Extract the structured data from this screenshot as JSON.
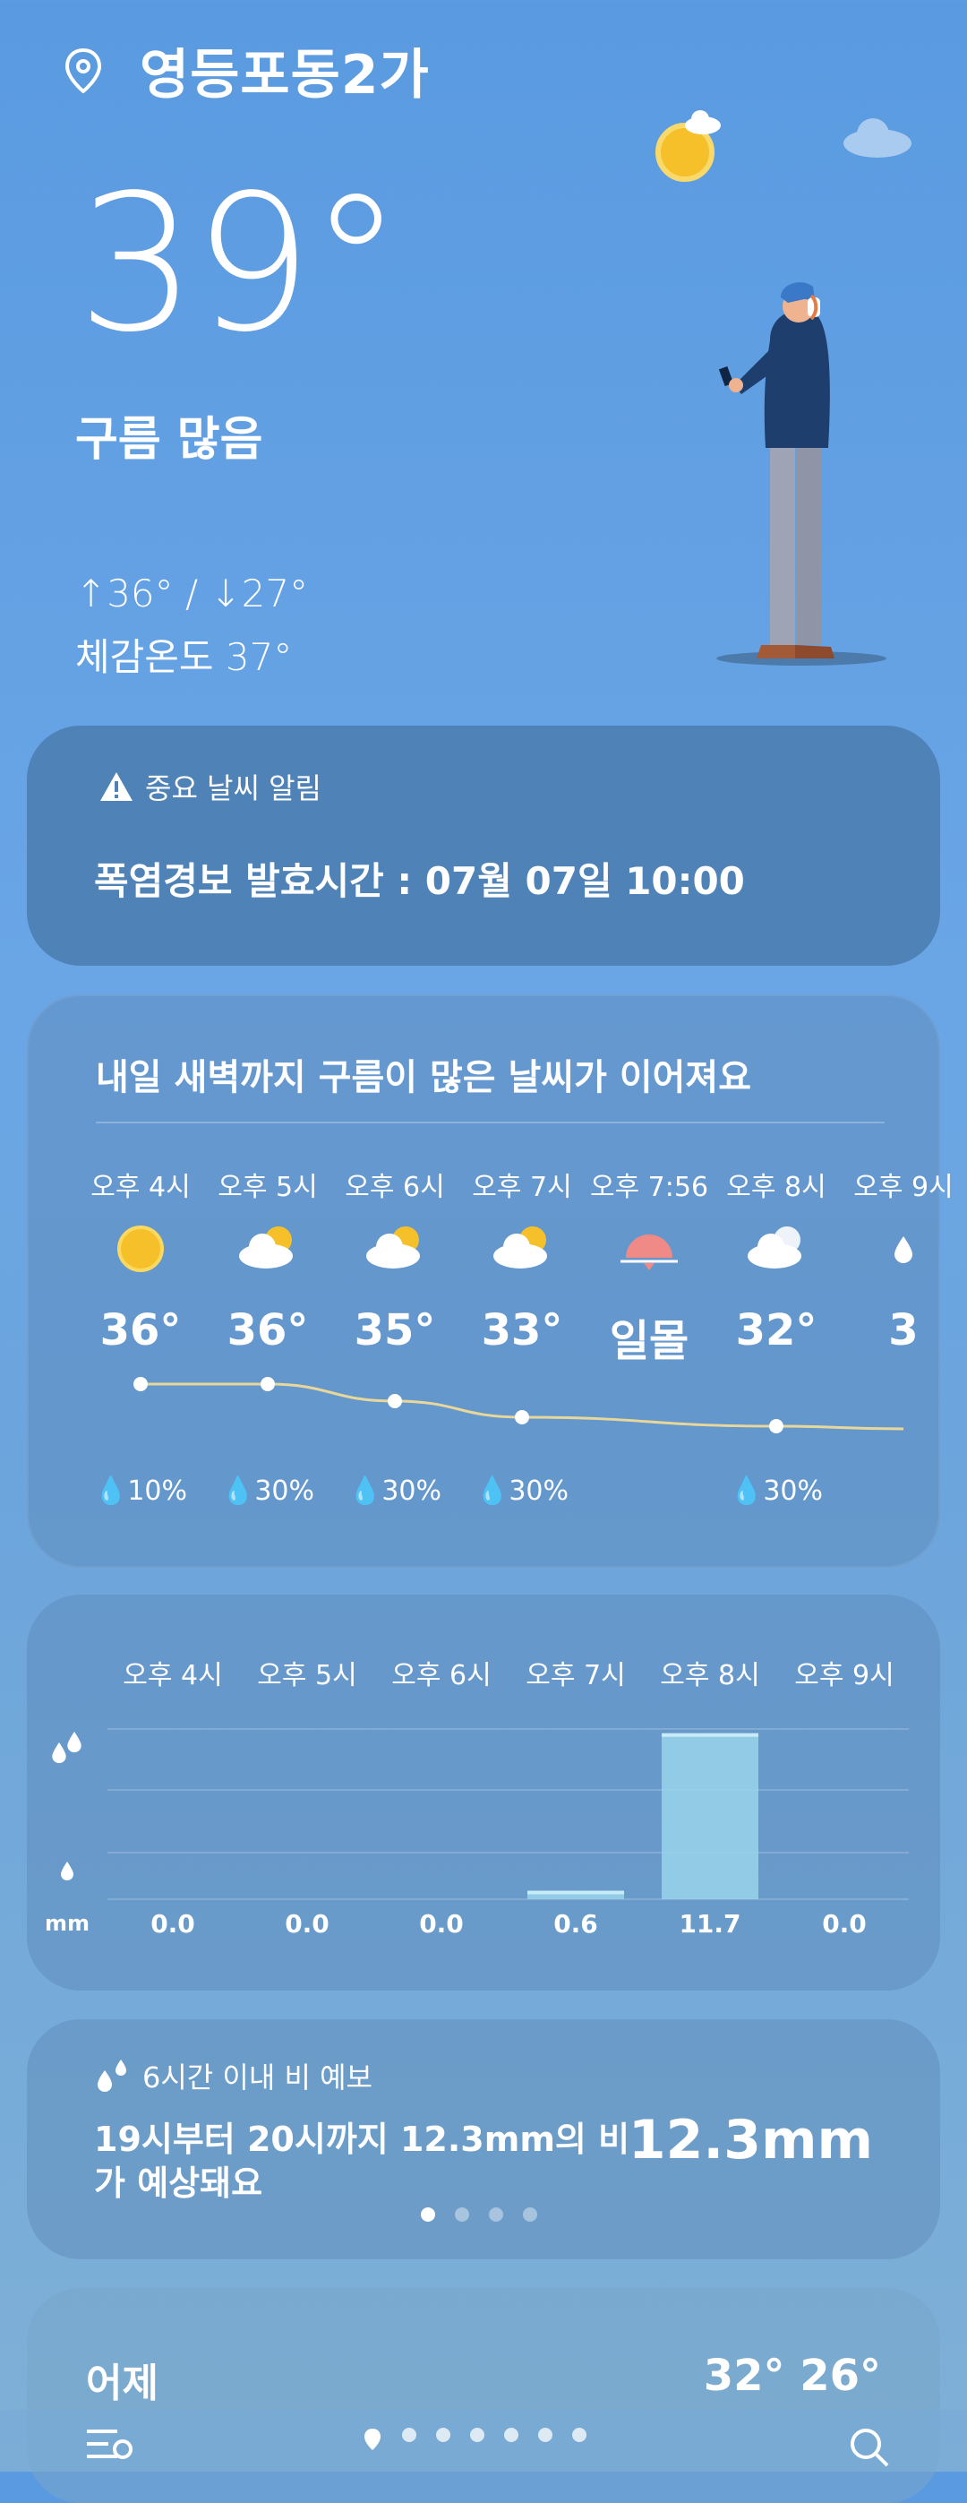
{
  "header": {
    "location": "영등포동2가"
  },
  "current": {
    "temp": "39°",
    "condition": "구름 많음",
    "hilo": "↑36° / ↓27°",
    "feels_like": "체감온도 37°"
  },
  "alert": {
    "title": "중요 날씨 알림",
    "text": "폭염경보  발효시간 : 07월 07일 10:00"
  },
  "hourly": {
    "title": "내일 새벽까지 구름이 많은 날씨가 이어져요",
    "items": [
      {
        "time": "오후 4시",
        "temp": "36°",
        "pop": "10%",
        "icon": "sun-icon"
      },
      {
        "time": "오후 5시",
        "temp": "36°",
        "pop": "30%",
        "icon": "partly-cloudy-icon"
      },
      {
        "time": "오후 6시",
        "temp": "35°",
        "pop": "30%",
        "icon": "partly-cloudy-icon"
      },
      {
        "time": "오후 7시",
        "temp": "33°",
        "pop": "30%",
        "icon": "partly-cloudy-icon"
      },
      {
        "time": "오후 7:56",
        "temp": "일몰",
        "pop": "",
        "icon": "sunset-icon"
      },
      {
        "time": "오후 8시",
        "temp": "32°",
        "pop": "30%",
        "icon": "cloudy-night-icon"
      },
      {
        "time": "오후 9시",
        "temp": "3",
        "pop": "",
        "icon": "rain-icon"
      }
    ]
  },
  "rain_chart": {
    "unit": "mm",
    "chart_data": {
      "type": "bar",
      "categories": [
        "오후 4시",
        "오후 5시",
        "오후 6시",
        "오후 7시",
        "오후 8시",
        "오후 9시"
      ],
      "values": [
        0.0,
        0.0,
        0.0,
        0.6,
        11.7,
        0.0
      ],
      "labels": [
        "0.0",
        "0.0",
        "0.0",
        "0.6",
        "11.7",
        "0.0"
      ]
    }
  },
  "rain_forecast": {
    "title": "6시간 이내 비 예보",
    "text": "19시부터 20시까지 12.3mm의 비가 예상돼요",
    "amount": "12.3mm"
  },
  "yesterday": {
    "label": "어제",
    "temps": "32° 26°"
  },
  "colors": {
    "bg_top": "#5a9ae0",
    "alert_card": "#4f82b6",
    "bar_fill": "#9ad4ea",
    "sun": "#f5c02a",
    "sunset": "#f08a86"
  }
}
